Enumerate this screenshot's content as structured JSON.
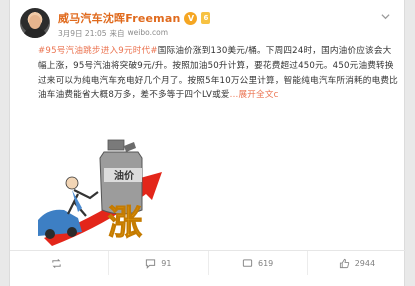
{
  "post": {
    "author": "威马汽车沈晖Freeman",
    "verified_badge": "V",
    "level_badge": "6",
    "date": "3月9日 21:05",
    "source_prefix": "来自",
    "source": "weibo.com",
    "topic": "#95号汽油跳步进入9元时代#",
    "text": "国际油价涨到130美元/桶。下周四24时，国内油价应该会大幅上涨，95号汽油将突破9元/升。按照加油50升计算，要花费超过450元。450元油费转换过来可以为纯电汽车充电好几个月了。按照5年10万公里计算，智能纯电汽车所消耗的电费比油车油费能省大概8万多，差不多等于四个LV或爱",
    "more_label": "...展开全文c",
    "image": {
      "can_label": "油价",
      "rise_char": "涨"
    }
  },
  "actions": {
    "repost": "",
    "comments": "91",
    "likes_hidden": "",
    "comments_count": "619",
    "likes": "2944"
  },
  "colors": {
    "author": "#e06a1d",
    "topic": "#eb7350",
    "arrow": "#e3261a",
    "badge": "#f5a623"
  }
}
